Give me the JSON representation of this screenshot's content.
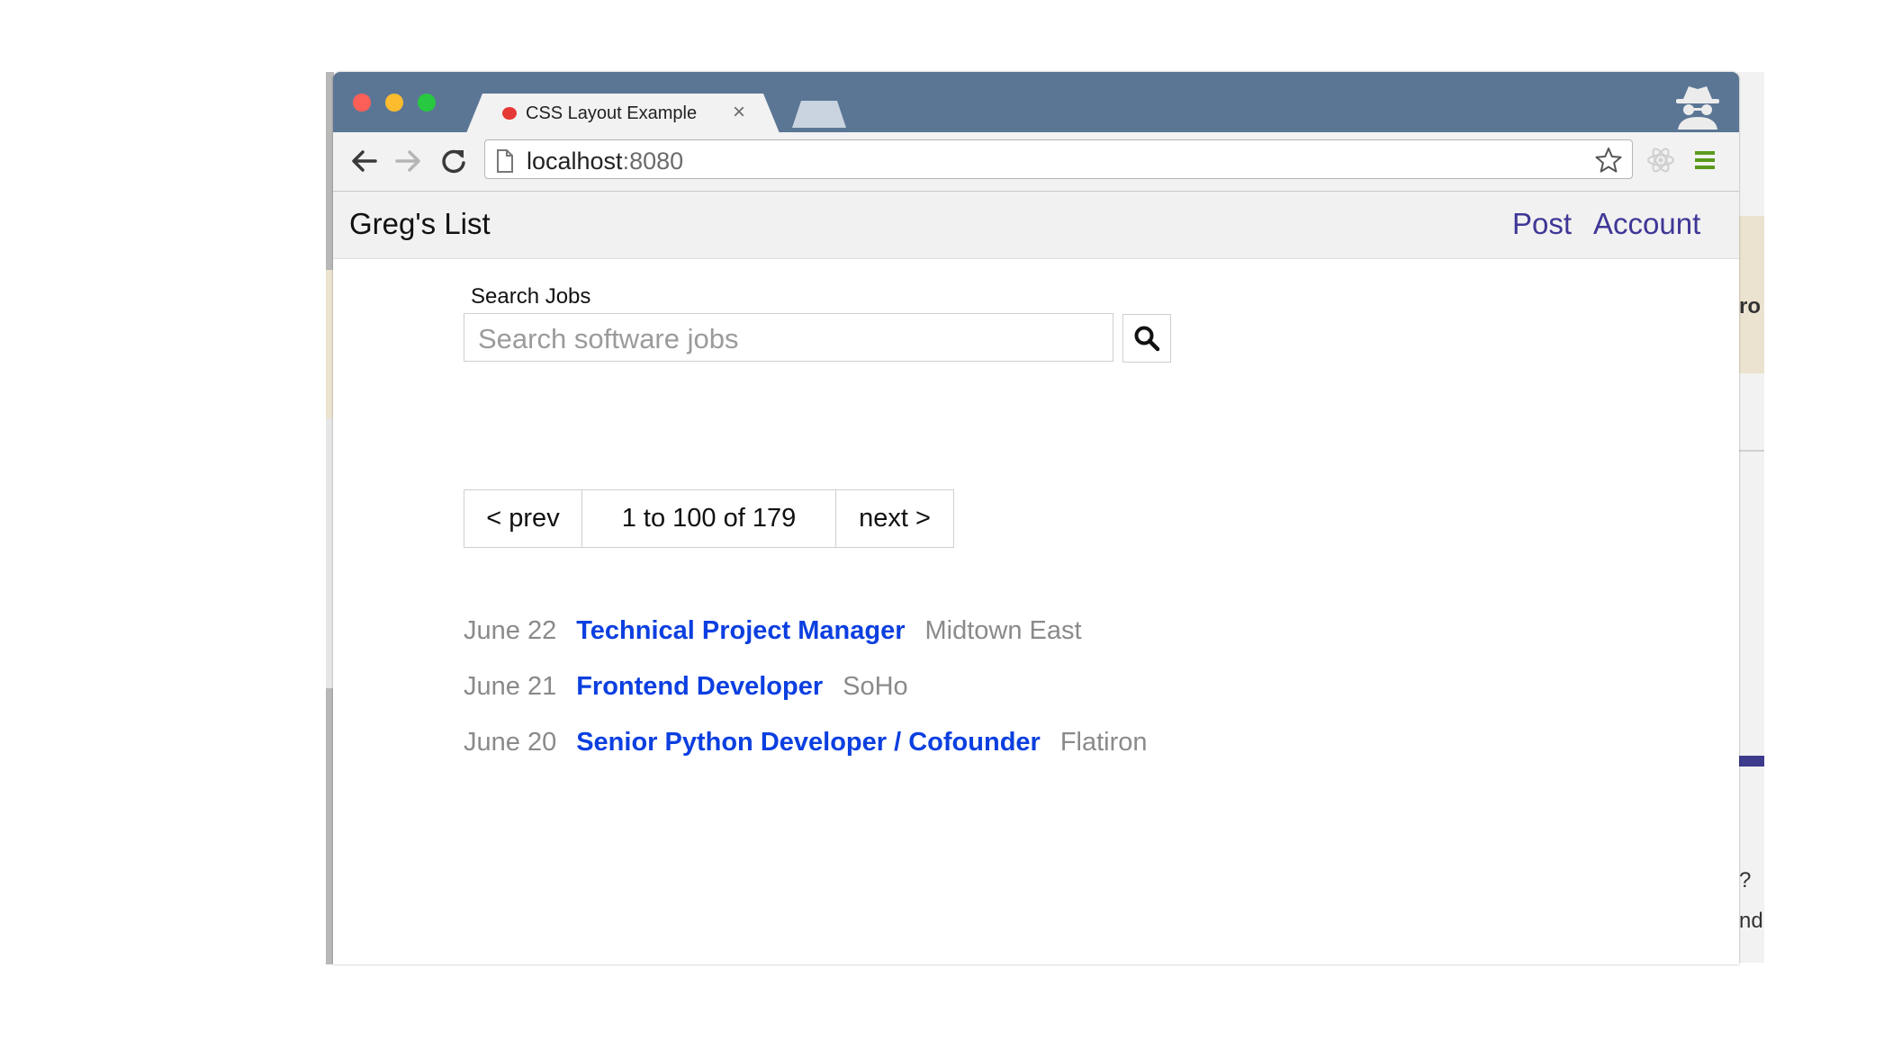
{
  "browser": {
    "tab_title": "CSS Layout Example",
    "tab_close": "×",
    "url_host": "localhost",
    "url_port": ":8080"
  },
  "site": {
    "title": "Greg's List",
    "nav": [
      "Post",
      "Account"
    ]
  },
  "search": {
    "label": "Search Jobs",
    "placeholder": "Search software jobs"
  },
  "pager": {
    "prev": "< prev",
    "range": "1 to 100 of 179",
    "next": "next >"
  },
  "jobs": [
    {
      "date": "June 22",
      "title": "Technical Project Manager",
      "location": "Midtown East"
    },
    {
      "date": "June 21",
      "title": "Frontend Developer",
      "location": "SoHo"
    },
    {
      "date": "June 20",
      "title": "Senior Python Developer / Cofounder",
      "location": "Flatiron"
    }
  ],
  "background_window": {
    "fragments": [
      "ro",
      "?",
      "nd"
    ]
  },
  "colors": {
    "titlebar": "#5b7695",
    "link": "#0b3fe0",
    "nav_link": "#3f3797",
    "muted": "#8a8a8a"
  }
}
